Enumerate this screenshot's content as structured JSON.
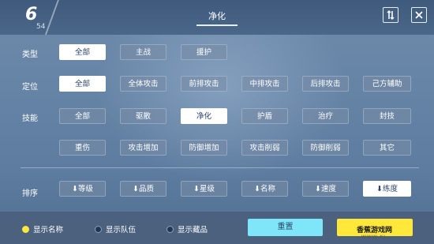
{
  "header": {
    "count": "6",
    "total": "54",
    "title": "净化"
  },
  "rows": {
    "type": {
      "label": "类型",
      "options": [
        "全部",
        "主战",
        "援护"
      ],
      "selected": 0
    },
    "position": {
      "label": "定位",
      "options": [
        "全部",
        "全体攻击",
        "前排攻击",
        "中排攻击",
        "后排攻击",
        "己方辅助"
      ],
      "selected": 0
    },
    "skill": {
      "label": "技能",
      "options": [
        "全部",
        "驱散",
        "净化",
        "护盾",
        "治疗",
        "封技",
        "重伤",
        "攻击增加",
        "防御增加",
        "攻击削弱",
        "防御削弱",
        "其它"
      ],
      "selected": 2
    },
    "sort": {
      "label": "排序",
      "options": [
        "⬇等级",
        "⬇品质",
        "⬇星级",
        "⬇名称",
        "⬇速度",
        "⬇练度"
      ],
      "selected": 5
    }
  },
  "footer": {
    "toggles": [
      {
        "label": "显示名称",
        "on": true
      },
      {
        "label": "显示队伍",
        "on": false
      },
      {
        "label": "显示藏品",
        "on": false
      }
    ],
    "reset_label": "重置"
  },
  "watermark": {
    "text": "香蕉游戏网",
    "sub": "WWW.XJ..."
  },
  "colors": {
    "accent_yellow": "#ffe83a",
    "accent_cyan": "#7ee6f8",
    "selected_chip": "#ffffff"
  }
}
